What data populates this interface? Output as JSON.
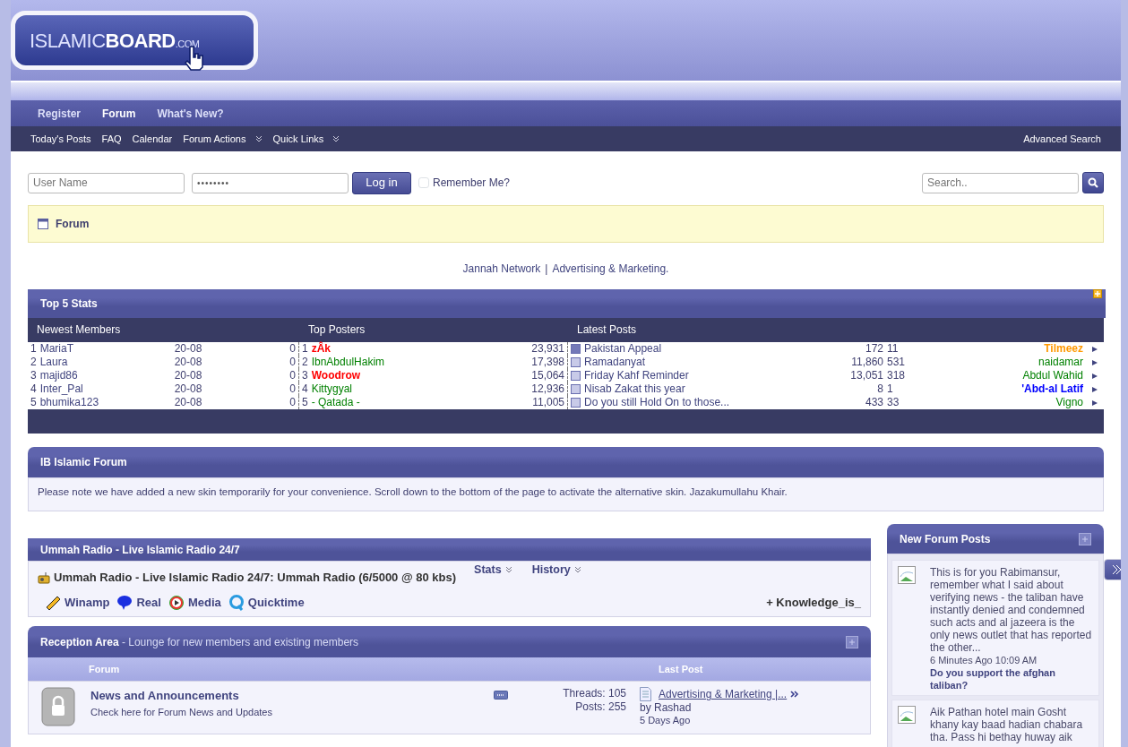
{
  "logo": {
    "parts": [
      "ISLAMIC",
      "BOARD",
      ".COM"
    ]
  },
  "navbar": [
    {
      "label": "Register",
      "selected": false
    },
    {
      "label": "Forum",
      "selected": true
    },
    {
      "label": "What's New?",
      "selected": false
    }
  ],
  "subnav": {
    "items": [
      {
        "label": "Today's Posts",
        "dropdown": false
      },
      {
        "label": "FAQ",
        "dropdown": false
      },
      {
        "label": "Calendar",
        "dropdown": false
      },
      {
        "label": "Forum Actions",
        "dropdown": true
      },
      {
        "label": "Quick Links",
        "dropdown": true
      }
    ],
    "right": "Advanced Search"
  },
  "login": {
    "username_placeholder": "User Name",
    "password": "••••••••",
    "button": "Log in",
    "remember": {
      "label": "Remember Me?",
      "checked": false
    },
    "search_placeholder": "Search.."
  },
  "breadcrumb": "Forum",
  "banner": {
    "links": [
      "Jannah Network",
      "Advertising & Marketing."
    ],
    "separator": "|"
  },
  "top_stats": {
    "title": "Top 5 Stats",
    "columns": [
      "Newest Members",
      "Top Posters",
      "Latest Posts"
    ],
    "members": [
      {
        "rank": "1",
        "name": "MariaT",
        "date": "20-08",
        "posts": "0"
      },
      {
        "rank": "2",
        "name": "Laura",
        "date": "20-08",
        "posts": "0"
      },
      {
        "rank": "3",
        "name": "majid86",
        "date": "20-08",
        "posts": "0"
      },
      {
        "rank": "4",
        "name": "Inter_Pal",
        "date": "20-08",
        "posts": "0"
      },
      {
        "rank": "5",
        "name": "bhumika123",
        "date": "20-08",
        "posts": "0"
      }
    ],
    "posters": [
      {
        "rank": "1",
        "name": "zÂk",
        "posts": "23,931",
        "color": "#ff0000",
        "bold": true
      },
      {
        "rank": "2",
        "name": "IbnAbdulHakim",
        "posts": "17,398",
        "color": "#008000",
        "bold": false
      },
      {
        "rank": "3",
        "name": "Woodrow",
        "posts": "15,064",
        "color": "#ff0000",
        "bold": true
      },
      {
        "rank": "4",
        "name": "Kittygyal",
        "posts": "12,936",
        "color": "#008000",
        "bold": false
      },
      {
        "rank": "5",
        "name": "- Qatada -",
        "posts": "11,005",
        "color": "#008000",
        "bold": false
      }
    ],
    "posts": [
      {
        "title": "Pakistan Appeal",
        "views": "172",
        "replies": "11",
        "user": "Tilmeez",
        "color": "#ff9900",
        "bold": true,
        "unread": true
      },
      {
        "title": "Ramadanyat",
        "views": "11,860",
        "replies": "531",
        "user": "naidamar",
        "color": "#008000",
        "bold": false,
        "unread": false
      },
      {
        "title": "Friday Kahf Reminder",
        "views": "13,051",
        "replies": "318",
        "user": "Abdul Wahid",
        "color": "#008000",
        "bold": false,
        "unread": false
      },
      {
        "title": "Nisab Zakat this year",
        "views": "8",
        "replies": "1",
        "user": "'Abd-al Latif",
        "color": "#0000ff",
        "bold": true,
        "unread": false
      },
      {
        "title": "Do you still Hold On to those...",
        "views": "433",
        "replies": "33",
        "user": "Vigno",
        "color": "#008000",
        "bold": false,
        "unread": false
      }
    ]
  },
  "notice": {
    "title": "IB Islamic Forum",
    "text": "Please note we have added a new skin temporarily for your convenience. Scroll down to the bottom of the page to activate the alternative skin. Jazakumullahu Khair."
  },
  "radio": {
    "title": "Ummah Radio - Live Islamic Radio 24/7",
    "status": "Ummah Radio - Live Islamic Radio 24/7: Ummah Radio (6/5000 @ 80 kbs)",
    "menus": [
      "Stats",
      "History"
    ],
    "players": [
      {
        "kind": "winamp",
        "label": "Winamp"
      },
      {
        "kind": "real",
        "label": "Real"
      },
      {
        "kind": "media",
        "label": "Media"
      },
      {
        "kind": "quicktime",
        "label": "Quicktime"
      }
    ],
    "listener": "+ Knowledge_is_"
  },
  "reception": {
    "title": "Reception Area",
    "subtitle": "- Lounge for new members and existing members",
    "columns": [
      "Forum",
      "Last Post"
    ],
    "forums": [
      {
        "name": "News and Announcements",
        "description": "Check here for Forum News and Updates",
        "threads": "Threads: 105",
        "posts": "Posts: 255",
        "last_title": "Advertising & Marketing |...",
        "last_by": "by Rashad",
        "last_time": "5 Days Ago"
      }
    ]
  },
  "new_posts": {
    "title": "New Forum Posts",
    "items": [
      {
        "text": "This is for you Rabimansur, remember what I said about verifying news - the taliban have instantly denied and condemned such acts and al jazeera is the only news outlet that has reported the other...",
        "time": "6 Minutes Ago 10:09 AM",
        "thread": "Do you support the afghan taliban?"
      },
      {
        "text": "Aik Pathan hotel main Gosht khany kay baad hadian chabara tha. Pass hi bethay huway aik"
      }
    ]
  }
}
